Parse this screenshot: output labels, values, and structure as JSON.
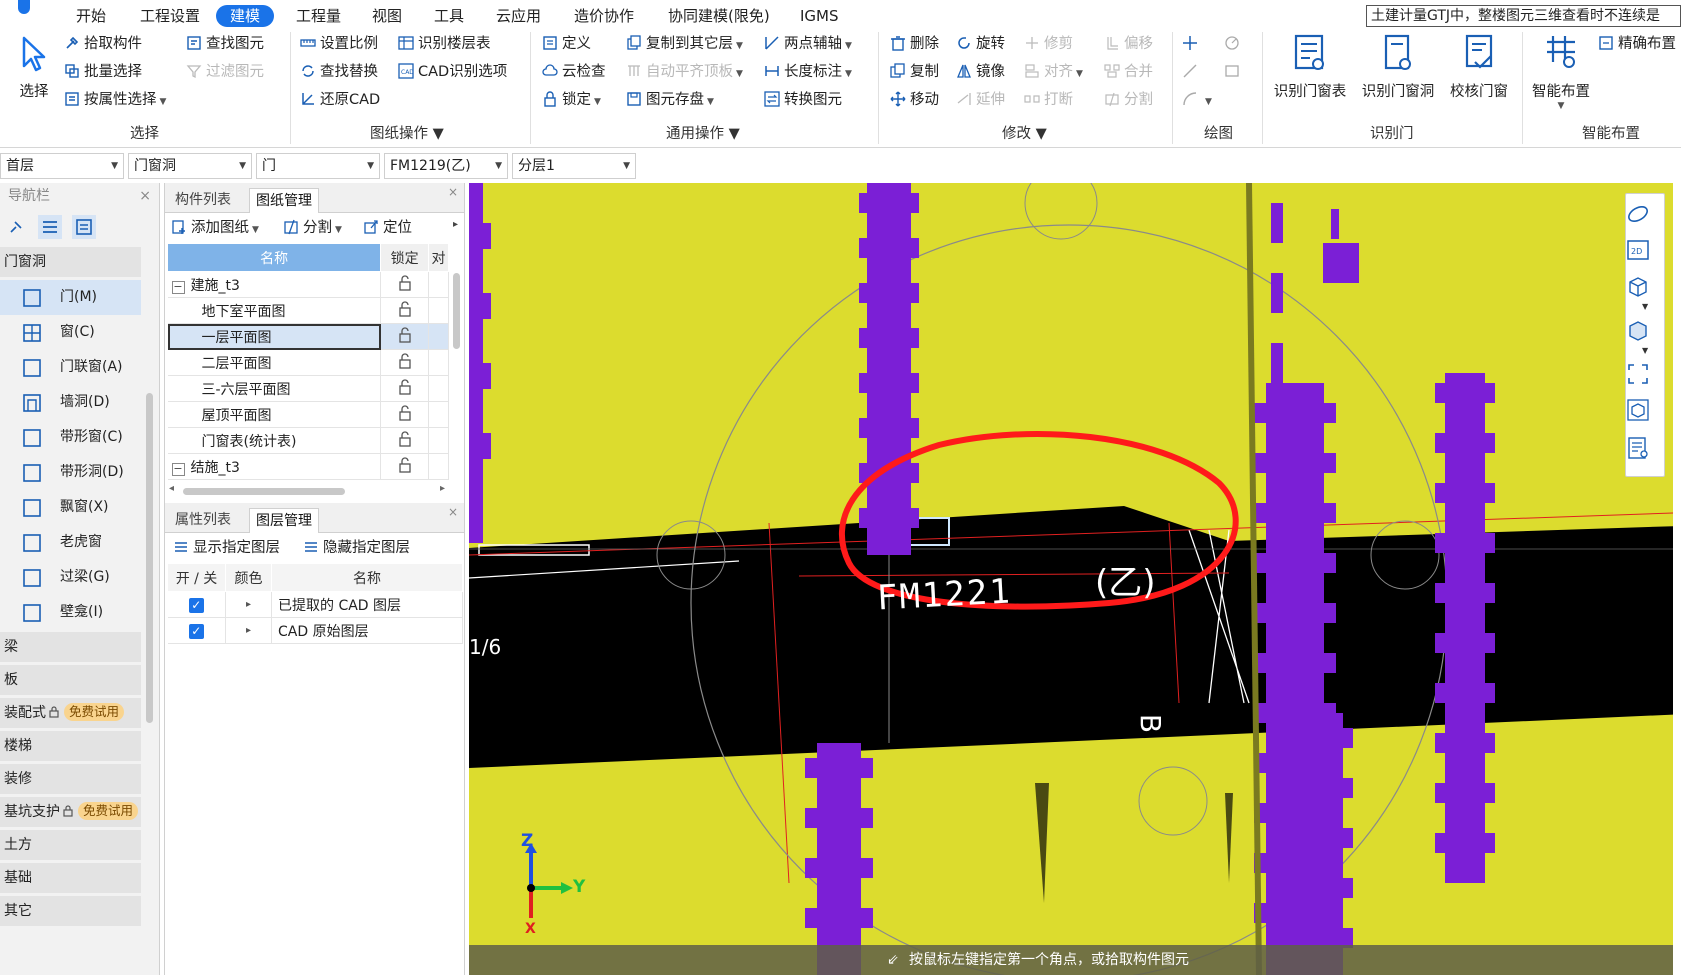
{
  "menu": {
    "items": [
      "开始",
      "工程设置",
      "建模",
      "工程量",
      "视图",
      "工具",
      "云应用",
      "造价协作",
      "协同建模(限免)",
      "IGMS"
    ],
    "active_index": 2,
    "notice": "土建计量GTJ中，整楼图元三维查看时不连续是"
  },
  "ribbon": {
    "select": {
      "label": "选择",
      "pick": "拾取构件",
      "batch": "批量选择",
      "by_attr": "按属性选择",
      "find": "查找图元",
      "filter": "过滤图元",
      "group": "选择"
    },
    "drawing": {
      "scale": "设置比例",
      "floor_table": "识别楼层表",
      "find_replace": "查找替换",
      "cad_options": "CAD识别选项",
      "restore": "还原CAD",
      "group": "图纸操作"
    },
    "common": {
      "define": "定义",
      "copy_floor": "复制到其它层",
      "two_point": "两点辅轴",
      "cloud_check": "云检查",
      "auto_align": "自动平齐顶板",
      "length_mark": "长度标注",
      "lock": "锁定",
      "save": "图元存盘",
      "convert": "转换图元",
      "group": "通用操作"
    },
    "modify": {
      "delete": "删除",
      "rotate": "旋转",
      "trim": "修剪",
      "offset": "偏移",
      "copy": "复制",
      "mirror": "镜像",
      "align": "对齐",
      "merge": "合并",
      "move": "移动",
      "extend": "延伸",
      "break": "打断",
      "split": "分割",
      "group": "修改"
    },
    "draw": {
      "group": "绘图"
    },
    "recognize": {
      "table": "识别门窗表",
      "opening": "识别门窗洞",
      "check": "校核门窗",
      "group": "识别门"
    },
    "smart": {
      "smart": "智能布置",
      "precise": "精确布置",
      "group": "智能布置"
    }
  },
  "selectors": [
    "首层",
    "门窗洞",
    "门",
    "FM1219(乙)",
    "分层1"
  ],
  "nav": {
    "title": "导航栏",
    "category": "门窗洞",
    "items": [
      "门(M)",
      "窗(C)",
      "门联窗(A)",
      "墙洞(D)",
      "带形窗(C)",
      "带形洞(D)",
      "飘窗(X)",
      "老虎窗",
      "过梁(G)",
      "壁龛(I)"
    ],
    "active_index": 0,
    "other_cats": [
      "梁",
      "板",
      "装配式",
      "楼梯",
      "装修",
      "基坑支护",
      "土方",
      "基础",
      "其它"
    ],
    "trial_label": "免费试用"
  },
  "drawings_panel": {
    "tabs": [
      "构件列表",
      "图纸管理"
    ],
    "active_tab": 1,
    "toolbar": {
      "add": "添加图纸",
      "split": "分割",
      "locate": "定位"
    },
    "columns": [
      "名称",
      "锁定",
      "对"
    ],
    "rows": [
      {
        "name": "建施_t3",
        "level": 0,
        "toggle": "−"
      },
      {
        "name": "地下室平面图",
        "level": 1
      },
      {
        "name": "一层平面图",
        "level": 1,
        "selected": true
      },
      {
        "name": "二层平面图",
        "level": 1
      },
      {
        "name": "三-六层平面图",
        "level": 1
      },
      {
        "name": "屋顶平面图",
        "level": 1
      },
      {
        "name": "门窗表(统计表)",
        "level": 1
      },
      {
        "name": "结施_t3",
        "level": 0,
        "toggle": "−"
      }
    ]
  },
  "layers_panel": {
    "tabs": [
      "属性列表",
      "图层管理"
    ],
    "active_tab": 1,
    "toolbar": {
      "show": "显示指定图层",
      "hide": "隐藏指定图层"
    },
    "columns": [
      "开 / 关",
      "颜色",
      "名称"
    ],
    "rows": [
      {
        "name": "已提取的 CAD 图层",
        "on": true
      },
      {
        "name": "CAD 原始图层",
        "on": true
      }
    ]
  },
  "canvas": {
    "label_door": "FM1221",
    "label_grade": "(乙)",
    "label_axis": "1/6",
    "label_b": "B",
    "axis_z": "Z",
    "axis_y": "Y",
    "axis_x": "X",
    "status": "按鼠标左键指定第一个角点，或拾取构件图元",
    "colors": {
      "wall": "#dcdc2e",
      "column": "#7b1fd6",
      "cad": "#000000",
      "mark": "#ff1a1a"
    }
  }
}
